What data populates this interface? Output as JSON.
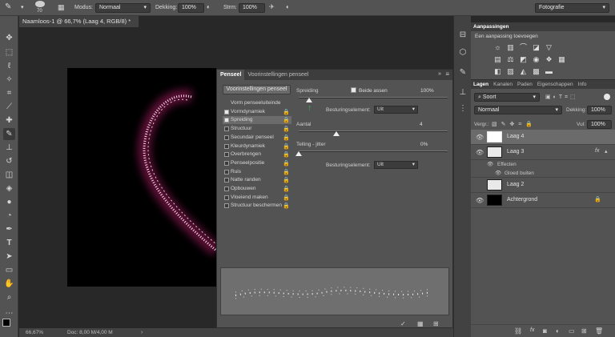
{
  "options_bar": {
    "brush_size": "70",
    "mode_label": "Modus:",
    "mode_value": "Normaal",
    "opacity_label": "Dekking:",
    "opacity_value": "100%",
    "flow_label": "Strm:",
    "flow_value": "100%",
    "workspace": "Fotografie"
  },
  "document": {
    "tab_title": "Naamloos-1 @ 66,7% (Laag 4, RGB/8) *",
    "zoom": "66,67%",
    "doc_info": "Doc: 8,00 M/4,00 M"
  },
  "brush_panel": {
    "tabs": [
      "Penseel",
      "Voorinstellingen penseel"
    ],
    "presets_button": "Voorinstellingen penseel",
    "items": [
      {
        "label": "Vorm penseeluiteinde",
        "checkbox": false,
        "checked": false,
        "lock": false
      },
      {
        "label": "Vormdynamiek",
        "checkbox": true,
        "checked": true,
        "lock": true
      },
      {
        "label": "Spreiding",
        "checkbox": true,
        "checked": true,
        "lock": true
      },
      {
        "label": "Structuur",
        "checkbox": true,
        "checked": false,
        "lock": true
      },
      {
        "label": "Secundair penseel",
        "checkbox": true,
        "checked": false,
        "lock": true
      },
      {
        "label": "Kleurdynamiek",
        "checkbox": true,
        "checked": false,
        "lock": true
      },
      {
        "label": "Overbrengen",
        "checkbox": true,
        "checked": false,
        "lock": true
      },
      {
        "label": "Penseelpositie",
        "checkbox": true,
        "checked": false,
        "lock": true
      },
      {
        "label": "Ruis",
        "checkbox": true,
        "checked": false,
        "lock": true
      },
      {
        "label": "Natte randen",
        "checkbox": true,
        "checked": false,
        "lock": true
      },
      {
        "label": "Opbouwen",
        "checkbox": true,
        "checked": false,
        "lock": true
      },
      {
        "label": "Vloeiend maken",
        "checkbox": true,
        "checked": false,
        "lock": true
      },
      {
        "label": "Structuur beschermen",
        "checkbox": true,
        "checked": false,
        "lock": true
      }
    ],
    "scatter_label": "Spreiding",
    "both_axes_label": "Beide assen",
    "scatter_value": "100%",
    "scatter_level": 0.07,
    "control_label": "Besturingselement:",
    "control_value": "Uit",
    "count_label": "Aantal",
    "count_value": "4",
    "count_level": 0.25,
    "count_jitter_label": "Telling - jitter",
    "count_jitter_value": "0%",
    "count_jitter_level": 0.0,
    "control2_label": "Besturingselement:",
    "control2_value": "Uit"
  },
  "adjustments_panel": {
    "title": "Aanpassingen",
    "subtitle": "Een aanpassing toevoegen"
  },
  "layers_panel": {
    "tabs": [
      "Lagen",
      "Kanalen",
      "Paden",
      "Eigenschappen",
      "Info"
    ],
    "filter_label": "Soort",
    "blend_mode": "Normaal",
    "opacity_label": "Dekking:",
    "opacity_value": "100%",
    "lock_label": "Vergr.:",
    "fill_label": "Vul:",
    "fill_value": "100%",
    "layers": [
      {
        "name": "Laag 4",
        "selected": true,
        "visible": true
      },
      {
        "name": "Laag 3",
        "selected": false,
        "visible": true,
        "fx": "fx"
      },
      {
        "name": "Laag 2",
        "selected": false,
        "visible": false
      },
      {
        "name": "Achtergrond",
        "selected": false,
        "visible": true
      }
    ],
    "effects_label": "Effecten",
    "glow_label": "Gloed buiten"
  }
}
